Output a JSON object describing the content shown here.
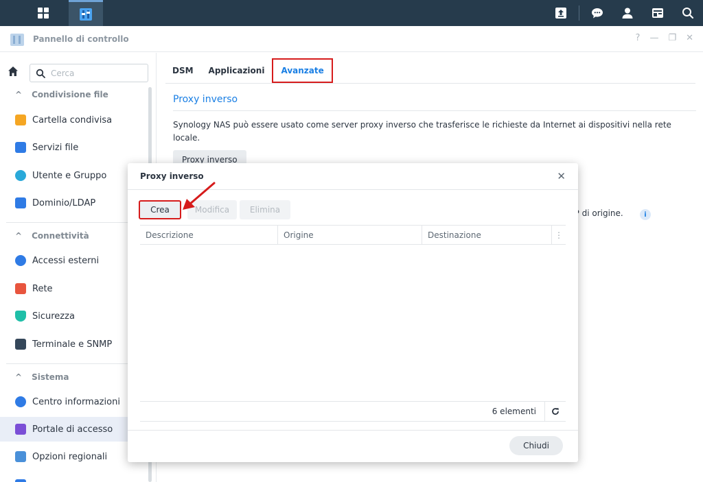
{
  "window": {
    "title": "Pannello di controllo"
  },
  "sidebar": {
    "search_placeholder": "Cerca",
    "sections": [
      {
        "label": "Condivisione file"
      },
      {
        "label": "Connettività"
      },
      {
        "label": "Sistema"
      }
    ],
    "items": [
      {
        "label": "Cartella condivisa",
        "icon": "folder-icon",
        "color": "#f5a623"
      },
      {
        "label": "Servizi file",
        "icon": "file-services-icon",
        "color": "#2f7be5"
      },
      {
        "label": "Utente e Gruppo",
        "icon": "users-icon",
        "color": "#2aa9d9"
      },
      {
        "label": "Dominio/LDAP",
        "icon": "domain-icon",
        "color": "#2f7be5"
      },
      {
        "label": "Accessi esterni",
        "icon": "external-access-icon",
        "color": "#2f7be5"
      },
      {
        "label": "Rete",
        "icon": "house-icon",
        "color": "#e8553e"
      },
      {
        "label": "Sicurezza",
        "icon": "shield-icon",
        "color": "#1fbfa8"
      },
      {
        "label": "Terminale e SNMP",
        "icon": "terminal-icon",
        "color": "#35475a"
      },
      {
        "label": "Centro informazioni",
        "icon": "info-icon",
        "color": "#2f7be5"
      },
      {
        "label": "Portale di accesso",
        "icon": "portal-icon",
        "color": "#7b4fd6"
      },
      {
        "label": "Opzioni regionali",
        "icon": "regional-icon",
        "color": "#4a90d9"
      }
    ]
  },
  "main": {
    "tabs": [
      {
        "label": "DSM"
      },
      {
        "label": "Applicazioni"
      },
      {
        "label": "Avanzate"
      }
    ],
    "section_title": "Proxy inverso",
    "description": "Synology NAS può essere usato come server proxy inverso che trasferisce le richieste da Internet ai dispositivi nella rete locale.",
    "proxy_button": "Proxy inverso",
    "background_text": "IP di origine.",
    "info_icon": "i"
  },
  "dialog": {
    "title": "Proxy inverso",
    "buttons": {
      "create": "Crea",
      "edit": "Modifica",
      "delete": "Elimina",
      "close": "Chiudi"
    },
    "columns": [
      "Descrizione",
      "Origine",
      "Destinazione"
    ],
    "count": "6 elementi"
  },
  "colors": {
    "accent": "#1a7fe4",
    "highlight": "#d61b1b",
    "taskbar": "#263b4c"
  }
}
